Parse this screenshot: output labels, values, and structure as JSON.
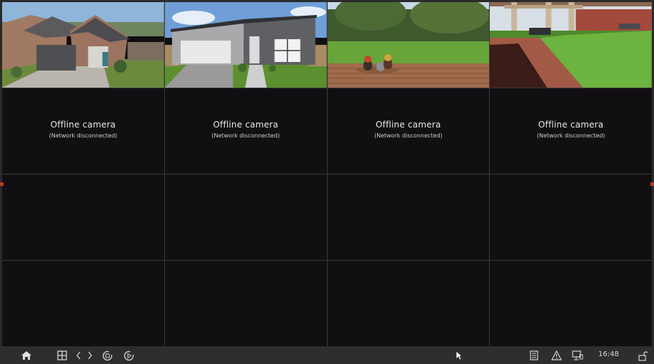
{
  "cameras": [
    {
      "index": 1,
      "state": "live",
      "scene": "brick-house-driveway"
    },
    {
      "index": 2,
      "state": "live",
      "scene": "modern-house-garage"
    },
    {
      "index": 3,
      "state": "live",
      "scene": "deck-backyard"
    },
    {
      "index": 4,
      "state": "live",
      "scene": "patio-pergola"
    },
    {
      "index": 5,
      "state": "offline",
      "title": "Offline camera",
      "detail": "(Network disconnected)"
    },
    {
      "index": 6,
      "state": "offline",
      "title": "Offline camera",
      "detail": "(Network disconnected)"
    },
    {
      "index": 7,
      "state": "offline",
      "title": "Offline camera",
      "detail": "(Network disconnected)"
    },
    {
      "index": 8,
      "state": "offline",
      "title": "Offline camera",
      "detail": "(Network disconnected)"
    },
    {
      "index": 9,
      "state": "empty"
    },
    {
      "index": 10,
      "state": "empty"
    },
    {
      "index": 11,
      "state": "empty"
    },
    {
      "index": 12,
      "state": "empty"
    },
    {
      "index": 13,
      "state": "empty"
    },
    {
      "index": 14,
      "state": "empty"
    },
    {
      "index": 15,
      "state": "empty"
    },
    {
      "index": 16,
      "state": "empty"
    }
  ],
  "taskbar": {
    "left_icons": [
      "home-icon",
      "layout-grid-icon",
      "prev-page-icon",
      "next-page-icon",
      "sequence-icon",
      "playback-icon"
    ],
    "right_icons": [
      "log-icon",
      "alarm-icon",
      "network-icon",
      "lock-icon"
    ],
    "clock": "16:48"
  },
  "colors": {
    "tile_bg": "#110f11",
    "grid_line": "#3a3a3a",
    "taskbar_bg": "#2e2e2e",
    "marker": "#c0392b"
  }
}
